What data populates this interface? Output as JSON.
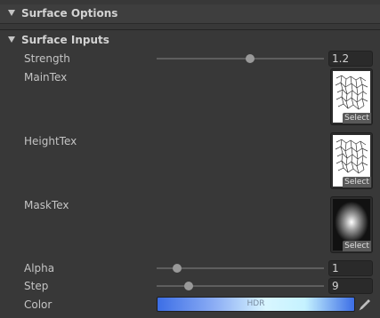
{
  "surface_options": {
    "title": "Surface Options"
  },
  "surface_inputs": {
    "title": "Surface Inputs",
    "strength": {
      "label": "Strength",
      "value": "1.2",
      "slider_fraction": 0.56
    },
    "main_tex": {
      "label": "MainTex",
      "select_label": "Select"
    },
    "height_tex": {
      "label": "HeightTex",
      "select_label": "Select"
    },
    "mask_tex": {
      "label": "MaskTex",
      "select_label": "Select"
    },
    "alpha": {
      "label": "Alpha",
      "value": "1",
      "slider_fraction": 0.12
    },
    "step": {
      "label": "Step",
      "value": "9",
      "slider_fraction": 0.19
    },
    "color": {
      "label": "Color",
      "hdr_label": "HDR"
    }
  },
  "icons": {
    "fold": "triangle-down-icon",
    "eyedropper": "eyedropper-icon"
  },
  "colors": {
    "panel_bg": "#383838",
    "hdr_gradient_start": "#3c6ee6",
    "hdr_gradient_mid": "#d8f6ff"
  }
}
